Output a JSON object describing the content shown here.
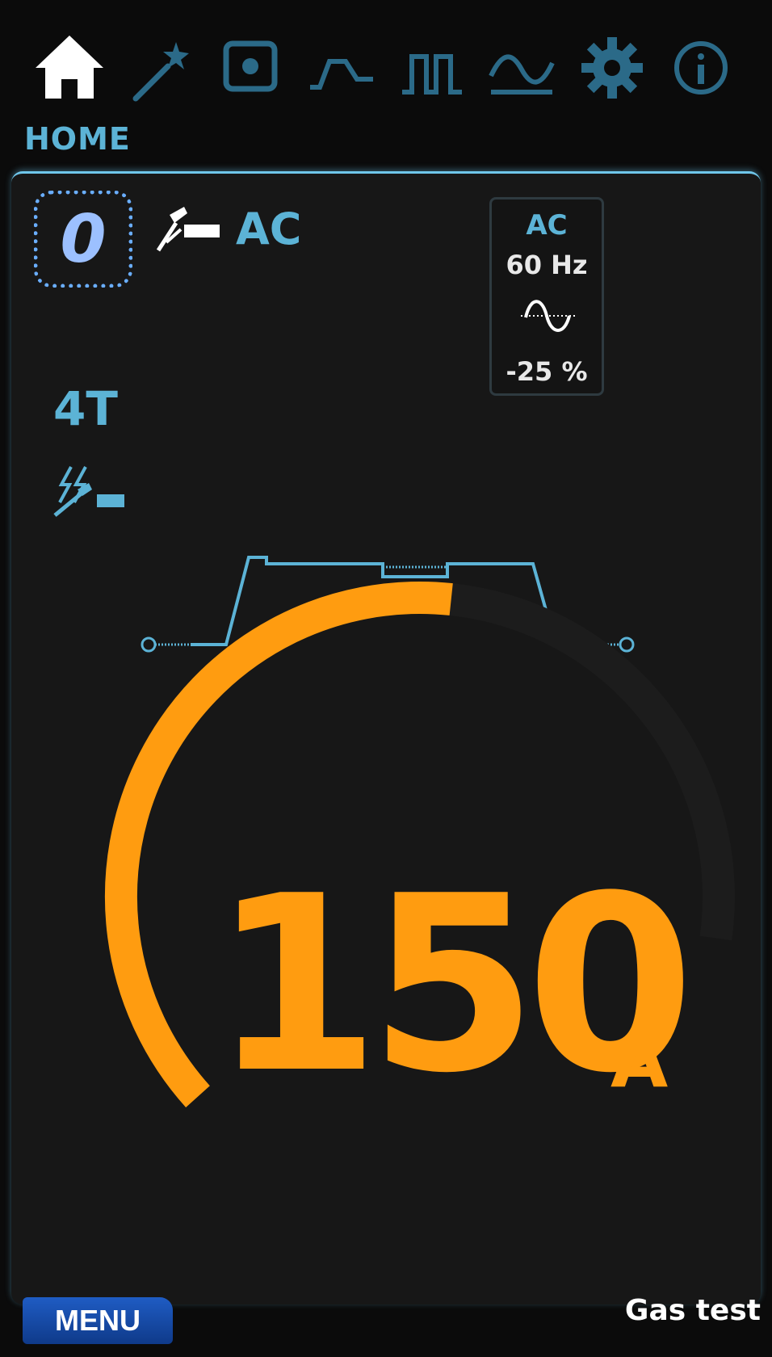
{
  "nav": {
    "title": "HOME",
    "icons": [
      "home-icon",
      "wizard-icon",
      "spot-icon",
      "pulse-shape-icon",
      "pulse-square-icon",
      "ac-wave-icon",
      "gear-icon",
      "info-icon"
    ]
  },
  "job": {
    "number": "0"
  },
  "process": {
    "current_type": "AC"
  },
  "ac_settings": {
    "type": "AC",
    "frequency": "60 Hz",
    "balance": "-25 %"
  },
  "trigger_mode": "4T",
  "welding": {
    "current": "150",
    "unit": "A",
    "gauge_fraction": 0.6
  },
  "footer": {
    "menu_label": "MENU",
    "gas_test_label": "Gas test"
  },
  "colors": {
    "accent_blue": "#5cb3d6",
    "current_orange": "#ff9c10",
    "job_blue": "#6aaeff",
    "menu_blue": "#1f5cc4"
  }
}
